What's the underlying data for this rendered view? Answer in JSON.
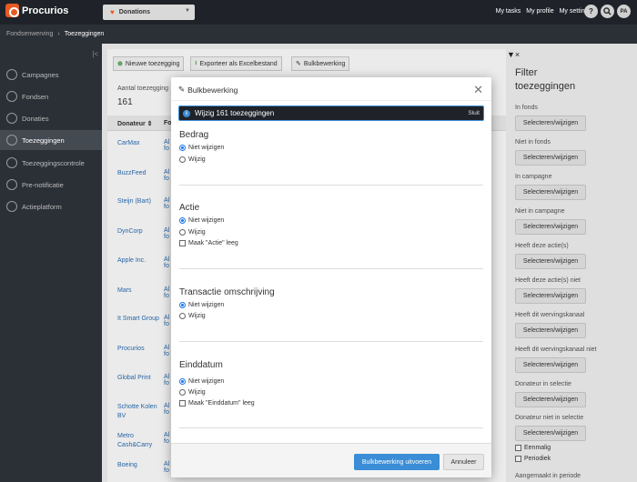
{
  "app": {
    "name": "Procurios",
    "module": "Donations"
  },
  "topbar": {
    "links": [
      "My tasks",
      "My profile",
      "My settings"
    ],
    "help": "?",
    "avatar": "PA"
  },
  "breadcrumb": {
    "parent": "Fondsenwerving",
    "current": "Toezeggingen"
  },
  "sidebar": {
    "items": [
      {
        "label": "Campagnes"
      },
      {
        "label": "Fondsen"
      },
      {
        "label": "Donaties"
      },
      {
        "label": "Toezeggingen"
      },
      {
        "label": "Toezeggingscontrole"
      },
      {
        "label": "Pre-notificatie"
      },
      {
        "label": "Actieplatform"
      }
    ]
  },
  "toolbar": {
    "new_label": "Nieuwe toezegging",
    "export_label": "Exporteer als Excelbestand",
    "bulk_label": "Bulkbewerking"
  },
  "main": {
    "count_label": "Aantal toezegging",
    "count_value": "161",
    "col_donateur": "Donateur ⇕",
    "col_fragment": "Fo",
    "rows": [
      {
        "name": "CarMax",
        "frag": "Al\nfo"
      },
      {
        "name": "BuzzFeed",
        "frag": "Al\nfo"
      },
      {
        "name": "Steijn (Bart)",
        "frag": "Al\nfo"
      },
      {
        "name": "DynCorp",
        "frag": "Al\nfo"
      },
      {
        "name": "Apple Inc.",
        "frag": "Al\nfo"
      },
      {
        "name": "Mars",
        "frag": "Al\nfo"
      },
      {
        "name": "It Smart Group",
        "frag": "Al\nfo"
      },
      {
        "name": "Procurios",
        "frag": "Al\nfo"
      },
      {
        "name": "Global Print",
        "frag": "Al\nfo"
      },
      {
        "name": "Schotte Kolen BV",
        "frag": "Al\nfo"
      },
      {
        "name": "Metro Cash&Carry",
        "frag": "Al\nfo"
      },
      {
        "name": "Boeing",
        "frag": "Al\nfo"
      }
    ]
  },
  "filter": {
    "title": "Filter toezeggingen",
    "button_label": "Selecteren/wijzigen",
    "groups": [
      "In fonds",
      "Niet in fonds",
      "In campagne",
      "Niet in campagne",
      "Heeft deze actie(s)",
      "Heeft deze actie(s) niet",
      "Heeft dit wervingskanaal",
      "Heeft dit wervingskanaal niet",
      "Donateur in selectie",
      "Donateur niet in selectie"
    ],
    "checks": [
      "Eenmalig",
      "Periodiek"
    ],
    "last_label": "Aangemaakt in periode"
  },
  "modal": {
    "title": "Bulkbewerking",
    "info": "Wijzig 161 toezeggingen",
    "info_close": "Sluit",
    "sections": [
      {
        "title": "Bedrag",
        "options": [
          "Niet wijzigen",
          "Wijzig"
        ]
      },
      {
        "title": "Actie",
        "options": [
          "Niet wijzigen",
          "Wijzig"
        ],
        "check": "Maak \"Actie\" leeg"
      },
      {
        "title": "Transactie omschrijving",
        "options": [
          "Niet wijzigen",
          "Wijzig"
        ]
      },
      {
        "title": "Einddatum",
        "options": [
          "Niet wijzigen",
          "Wijzig"
        ],
        "check": "Maak \"Einddatum\" leeg"
      }
    ],
    "submit_label": "Bulkbewerking uitvoeren",
    "cancel_label": "Annuleer"
  },
  "colors": {
    "accent": "#3a8dd6",
    "brand": "#e85a25",
    "topbar": "#1f2329"
  }
}
